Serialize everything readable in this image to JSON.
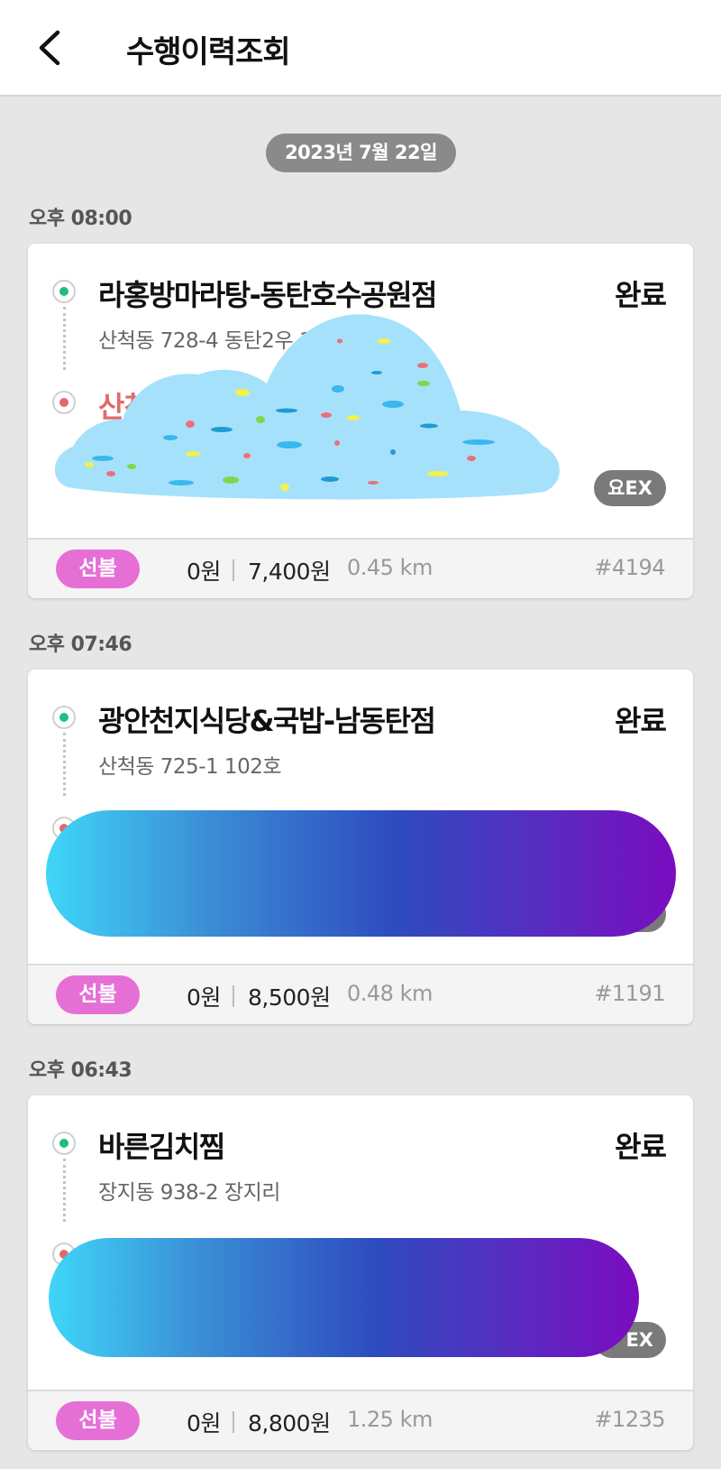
{
  "header": {
    "title": "수행이력조회",
    "back_icon": "chevron-left-icon"
  },
  "date_pill": "2023년 7월 22일",
  "orders": [
    {
      "time": "오후 08:00",
      "store": "라홍방마라탕-동탄호수공원점",
      "status": "완료",
      "store_address": "산척동 728-4 동탄2우                  117호",
      "dest_name": "산척동",
      "dest_address": "산",
      "badge": "요EX",
      "payment": "선불",
      "fee": "0원",
      "amount": "7,400원",
      "distance": "0.45 km",
      "order_no": "#4194"
    },
    {
      "time": "오후 07:46",
      "store": "광안천지식당&국밥-남동탄점",
      "status": "완료",
      "store_address": "산척동 725-1 102호",
      "payment": "선불",
      "fee": "0원",
      "amount": "8,500원",
      "distance": "0.48 km",
      "order_no": "#1191"
    },
    {
      "time": "오후 06:43",
      "store": "바른김치찜",
      "status": "완료",
      "store_address": "장지동 938-2 장지리",
      "badge": "EX",
      "payment": "선불",
      "fee": "0원",
      "amount": "8,800원",
      "distance": "1.25 km",
      "order_no": "#1235"
    }
  ],
  "colors": {
    "pay_pill": "#e66fd6",
    "status_dot_origin": "#1fbf7a",
    "status_dot_dest": "#e06a6a",
    "date_pill": "#8a8a8a"
  }
}
